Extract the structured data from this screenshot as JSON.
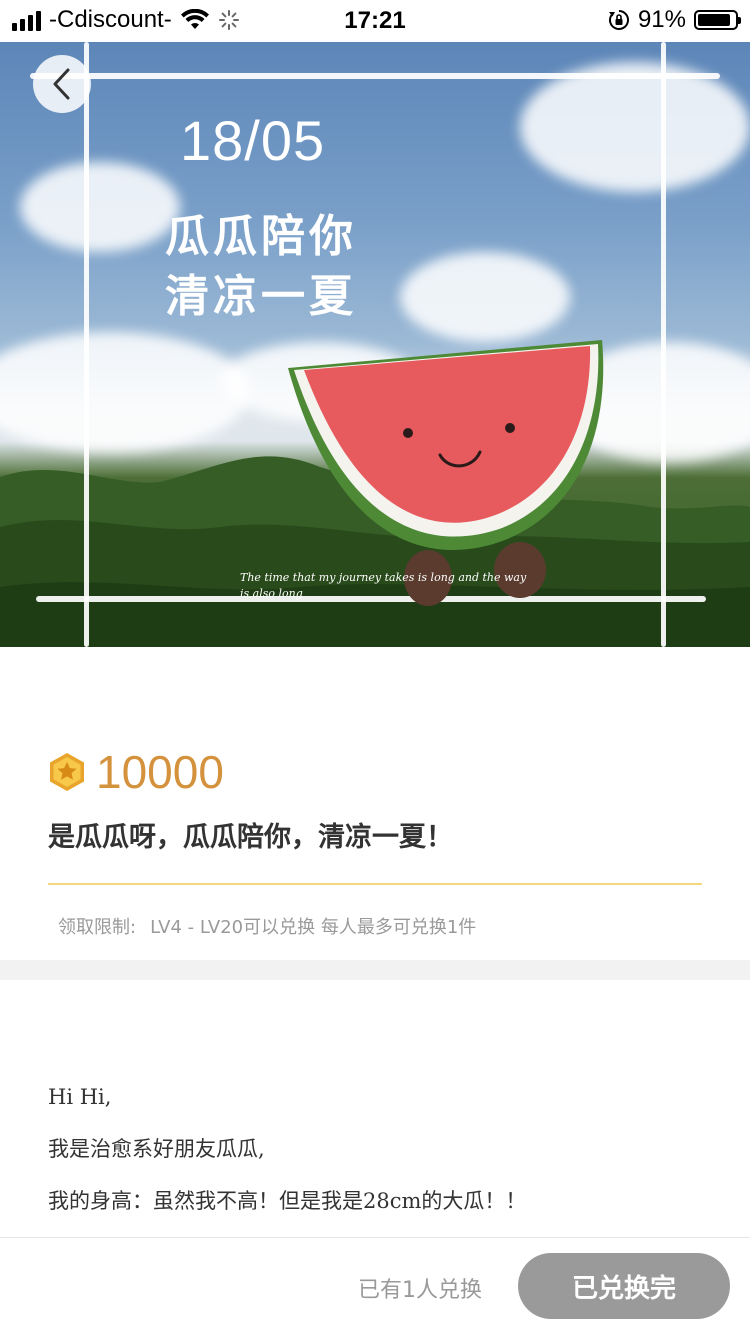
{
  "status_bar": {
    "carrier": "-Cdiscount-",
    "time": "17:21",
    "battery_percent": "91%",
    "battery_level": 0.91
  },
  "banner": {
    "date": "18/05",
    "headline_line1": "瓜瓜陪你",
    "headline_line2": "清凉一夏",
    "caption": "The time that my journey takes is long and the way is also long"
  },
  "back_button": {
    "icon": "chevron-left-icon"
  },
  "product": {
    "price": "10000",
    "price_icon": "star-coin-icon",
    "title": "是瓜瓜呀，瓜瓜陪你，清凉一夏！",
    "limit_label": "领取限制:",
    "limit_text": "LV4 - LV20可以兑换 每人最多可兑换1件"
  },
  "description": {
    "lines": [
      "Hi Hi,",
      "我是治愈系好朋友瓜瓜,",
      "我的身高：虽然我不高！但是我是28cm的大瓜！！"
    ]
  },
  "bottom_bar": {
    "redeemed_count_text": "已有1人兑换",
    "button_label": "已兑换完"
  },
  "colors": {
    "price": "#d4923d",
    "divider": "#f4d77e",
    "button_disabled": "#9a9a9a"
  }
}
